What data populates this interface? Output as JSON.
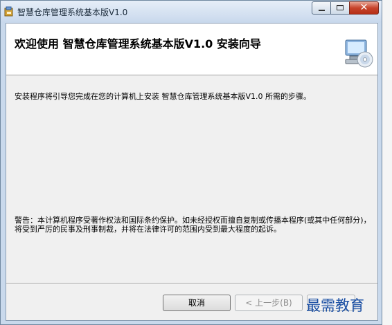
{
  "window": {
    "title": "智慧仓库管理系统基本版V1.0"
  },
  "header": {
    "title": "欢迎使用 智慧仓库管理系统基本版V1.0 安装向导"
  },
  "body": {
    "intro": "安装程序将引导您完成在您的计算机上安装 智慧仓库管理系统基本版V1.0 所需的步骤。",
    "warning": "警告：本计算机程序受著作权法和国际条约保护。如未经授权而擅自复制或传播本程序(或其中任何部分)，将受到严厉的民事及刑事制裁，并将在法律许可的范围内受到最大程度的起诉。"
  },
  "buttons": {
    "cancel": "取消",
    "back": "< 上一步(B)"
  },
  "watermark": "最需教育",
  "icons": {
    "app": "setup-app-icon",
    "wizard": "computer-cd-icon"
  }
}
